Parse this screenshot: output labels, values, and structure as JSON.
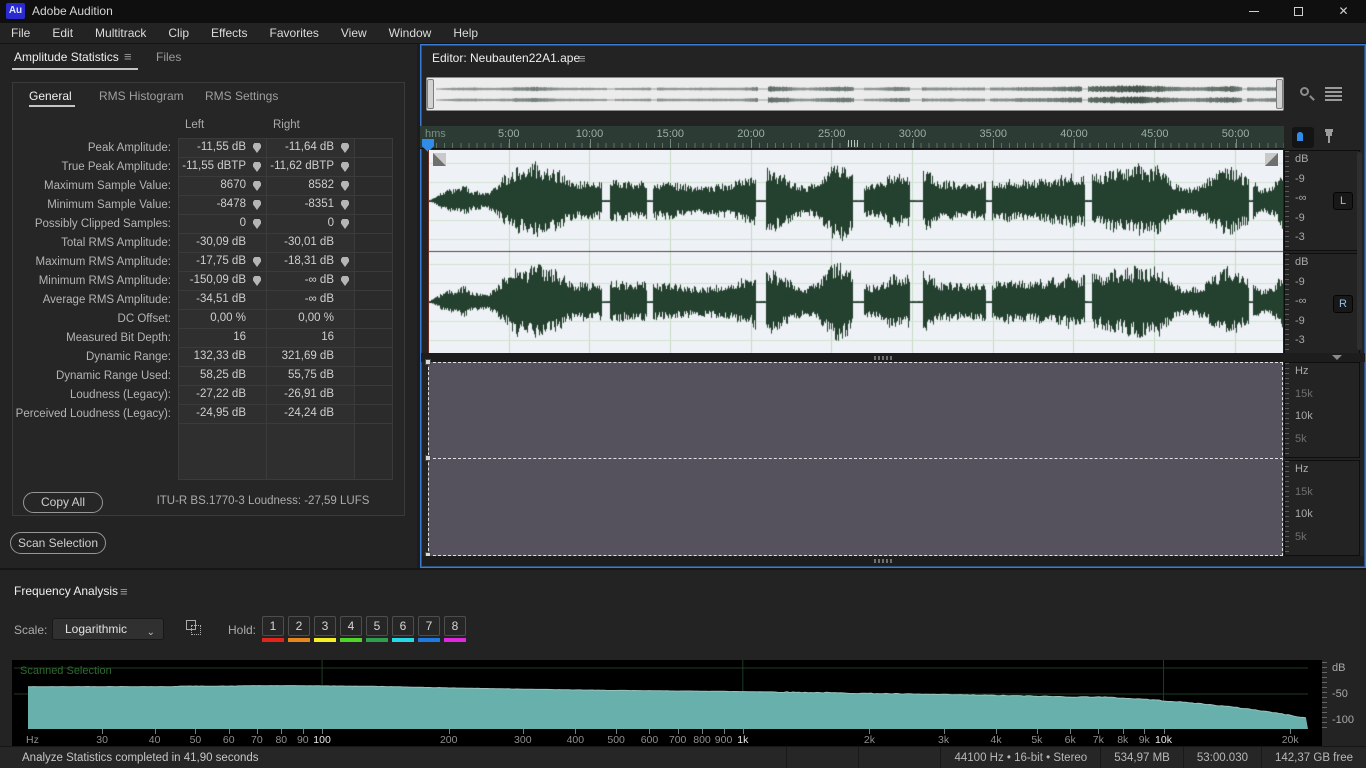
{
  "titlebar": {
    "logo": "Au",
    "title": "Adobe Audition",
    "minimize_glyph": "–",
    "close_glyph": "✕"
  },
  "menubar": {
    "items": [
      "File",
      "Edit",
      "Multitrack",
      "Clip",
      "Effects",
      "Favorites",
      "View",
      "Window",
      "Help"
    ]
  },
  "stats_panel": {
    "tabs": [
      {
        "label": "Amplitude Statistics",
        "active": true
      },
      {
        "label": "Files",
        "active": false
      }
    ],
    "menu_icon": "≡",
    "inner_tabs": [
      {
        "label": "General",
        "active": true
      },
      {
        "label": "RMS Histogram",
        "active": false
      },
      {
        "label": "RMS Settings",
        "active": false
      }
    ],
    "columns": [
      "Left",
      "Right"
    ],
    "rows": [
      {
        "label": "Peak Amplitude:",
        "left": "-11,55 dB",
        "right": "-11,64 dB",
        "pins": true
      },
      {
        "label": "True Peak Amplitude:",
        "left": "-11,55 dBTP",
        "right": "-11,62 dBTP",
        "pins": true
      },
      {
        "label": "Maximum Sample Value:",
        "left": "8670",
        "right": "8582",
        "pins": true
      },
      {
        "label": "Minimum Sample Value:",
        "left": "-8478",
        "right": "-8351",
        "pins": true
      },
      {
        "label": "Possibly Clipped Samples:",
        "left": "0",
        "right": "0",
        "pins": true
      },
      {
        "label": "Total RMS Amplitude:",
        "left": "-30,09 dB",
        "right": "-30,01 dB",
        "pins": false
      },
      {
        "label": "Maximum RMS Amplitude:",
        "left": "-17,75 dB",
        "right": "-18,31 dB",
        "pins": true
      },
      {
        "label": "Minimum RMS Amplitude:",
        "left": "-150,09 dB",
        "right": "-∞ dB",
        "pins": true
      },
      {
        "label": "Average RMS Amplitude:",
        "left": "-34,51 dB",
        "right": "-∞ dB",
        "pins": false
      },
      {
        "label": "DC Offset:",
        "left": "0,00 %",
        "right": "0,00 %",
        "pins": false
      },
      {
        "label": "Measured Bit Depth:",
        "left": "16",
        "right": "16",
        "pins": false
      },
      {
        "label": "Dynamic Range:",
        "left": "132,33 dB",
        "right": "321,69 dB",
        "pins": false
      },
      {
        "label": "Dynamic Range Used:",
        "left": "58,25 dB",
        "right": "55,75 dB",
        "pins": false
      },
      {
        "label": "Loudness (Legacy):",
        "left": "-27,22 dB",
        "right": "-26,91 dB",
        "pins": false
      },
      {
        "label": "Perceived Loudness (Legacy):",
        "left": "-24,95 dB",
        "right": "-24,24 dB",
        "pins": false
      }
    ],
    "copy_all_label": "Copy All",
    "itu_loudness": "ITU-R BS.1770-3 Loudness:  -27,59 LUFS",
    "scan_selection_label": "Scan Selection"
  },
  "editor": {
    "tab_label": "Editor: Neubauten22A1.ape",
    "menu_icon": "≡",
    "timeline": {
      "unit": "hms",
      "total_minutes": 53,
      "label_minutes": [
        5,
        10,
        15,
        20,
        25,
        30,
        35,
        40,
        45,
        50
      ],
      "labels": [
        "5:00",
        "10:00",
        "15:00",
        "20:00",
        "25:00",
        "30:00",
        "35:00",
        "40:00",
        "45:00",
        "50:00"
      ]
    },
    "db_scale": [
      "dB",
      "-9",
      "-∞",
      "-9",
      "-3"
    ],
    "hz_scale": [
      {
        "label": "Hz",
        "dim": false
      },
      {
        "label": "15k",
        "dim": true
      },
      {
        "label": "10k",
        "dim": false
      },
      {
        "label": "5k",
        "dim": true
      }
    ],
    "channels": [
      {
        "label": "L"
      },
      {
        "label": "R"
      }
    ],
    "waveform": {
      "seed": 7,
      "ramp_end": 0.045,
      "gaps": [
        [
          0,
          0.003
        ],
        [
          0.203,
          0.2125
        ],
        [
          0.2555,
          0.262
        ],
        [
          0.383,
          0.3945
        ],
        [
          0.497,
          0.5095
        ],
        [
          0.5635,
          0.578
        ],
        [
          0.6525,
          0.6585
        ],
        [
          0.768,
          0.7755
        ],
        [
          0.9595,
          0.9645
        ]
      ],
      "wave_color": "#24402e",
      "bg": "#eef1f5",
      "grid_h": "#d2e4d2",
      "grid_v": "#c6dcc6",
      "center_line": "#3c3c3c"
    },
    "spectrogram": {
      "palette_stops": [
        0,
        0.22,
        0.42,
        0.58,
        0.72,
        0.84,
        1
      ],
      "palette_rgb": [
        [
          86,
          82,
          94
        ],
        [
          99,
          88,
          110
        ],
        [
          125,
          90,
          134
        ],
        [
          176,
          94,
          150
        ],
        [
          224,
          105,
          154
        ],
        [
          240,
          138,
          120
        ],
        [
          255,
          184,
          102
        ]
      ]
    }
  },
  "freq_panel": {
    "title": "Frequency Analysis",
    "menu_icon": "≡",
    "scale_label": "Scale:",
    "scale_value": "Logarithmic",
    "chevron": "⌄",
    "hold_label": "Hold:",
    "hold_buttons": [
      {
        "label": "1",
        "color": "#e1251b"
      },
      {
        "label": "2",
        "color": "#e8871e"
      },
      {
        "label": "3",
        "color": "#f5ef28"
      },
      {
        "label": "4",
        "color": "#50d428"
      },
      {
        "label": "5",
        "color": "#2f9e4f"
      },
      {
        "label": "6",
        "color": "#28d8e8"
      },
      {
        "label": "7",
        "color": "#1e7ae0"
      },
      {
        "label": "8",
        "color": "#e028e0"
      }
    ]
  },
  "chart_data": {
    "type": "area",
    "title": "Scanned Selection",
    "xlabel": "Hz",
    "ylabel": "dB",
    "x_scale": "log",
    "x_range_hz": [
      20,
      22050
    ],
    "ylim": [
      -110,
      10
    ],
    "grid_hz": [
      100,
      1000,
      10000
    ],
    "grid_db": [
      0,
      -50
    ],
    "x_ticks": [
      {
        "label": "Hz",
        "f": 20,
        "bright": false,
        "edge": true
      },
      {
        "label": "30",
        "f": 30,
        "bright": false
      },
      {
        "label": "40",
        "f": 40,
        "bright": false
      },
      {
        "label": "50",
        "f": 50,
        "bright": false
      },
      {
        "label": "60",
        "f": 60,
        "bright": false
      },
      {
        "label": "70",
        "f": 70,
        "bright": false
      },
      {
        "label": "80",
        "f": 80,
        "bright": false
      },
      {
        "label": "90",
        "f": 90,
        "bright": false
      },
      {
        "label": "100",
        "f": 100,
        "bright": true
      },
      {
        "label": "200",
        "f": 200,
        "bright": false
      },
      {
        "label": "300",
        "f": 300,
        "bright": false
      },
      {
        "label": "400",
        "f": 400,
        "bright": false
      },
      {
        "label": "500",
        "f": 500,
        "bright": false
      },
      {
        "label": "600",
        "f": 600,
        "bright": false
      },
      {
        "label": "700",
        "f": 700,
        "bright": false
      },
      {
        "label": "800",
        "f": 800,
        "bright": false
      },
      {
        "label": "900",
        "f": 900,
        "bright": false
      },
      {
        "label": "1k",
        "f": 1000,
        "bright": true
      },
      {
        "label": "2k",
        "f": 2000,
        "bright": false
      },
      {
        "label": "3k",
        "f": 3000,
        "bright": false
      },
      {
        "label": "4k",
        "f": 4000,
        "bright": false
      },
      {
        "label": "5k",
        "f": 5000,
        "bright": false
      },
      {
        "label": "6k",
        "f": 6000,
        "bright": false
      },
      {
        "label": "7k",
        "f": 7000,
        "bright": false
      },
      {
        "label": "8k",
        "f": 8000,
        "bright": false
      },
      {
        "label": "9k",
        "f": 9000,
        "bright": false
      },
      {
        "label": "10k",
        "f": 10000,
        "bright": true
      },
      {
        "label": "20k",
        "f": 20000,
        "bright": false
      }
    ],
    "y_ticks": [
      {
        "label": "dB",
        "db": 0
      },
      {
        "label": "-50",
        "db": -50
      },
      {
        "label": "-100",
        "db": -100
      }
    ],
    "series": [
      {
        "name": "Scanned Selection",
        "points": [
          [
            20,
            -36
          ],
          [
            30,
            -35.8
          ],
          [
            44,
            -35.9
          ],
          [
            46,
            -34.9
          ],
          [
            62,
            -34.9
          ],
          [
            64,
            -34.2
          ],
          [
            78,
            -33.9
          ],
          [
            100,
            -34.4
          ],
          [
            130,
            -35.2
          ],
          [
            160,
            -36.6
          ],
          [
            200,
            -38.2
          ],
          [
            260,
            -39.8
          ],
          [
            320,
            -41
          ],
          [
            400,
            -42.2
          ],
          [
            500,
            -43.2
          ],
          [
            630,
            -43.9
          ],
          [
            800,
            -44.6
          ],
          [
            1000,
            -45.4
          ],
          [
            1300,
            -46.6
          ],
          [
            1600,
            -47.6
          ],
          [
            2000,
            -48.9
          ],
          [
            2500,
            -50.2
          ],
          [
            3150,
            -51.4
          ],
          [
            4000,
            -52.8
          ],
          [
            5000,
            -54.2
          ],
          [
            6300,
            -55.8
          ],
          [
            7000,
            -55.4
          ],
          [
            8000,
            -58
          ],
          [
            9000,
            -60
          ],
          [
            10000,
            -63
          ],
          [
            12000,
            -68
          ],
          [
            14000,
            -73.5
          ],
          [
            16000,
            -79
          ],
          [
            18000,
            -85
          ],
          [
            20000,
            -91
          ],
          [
            22050,
            -97
          ]
        ]
      }
    ],
    "fill_color": "#67b0ab",
    "line_color": "#98c2be",
    "bg": "#000000",
    "grid_color": "#1d3d22"
  },
  "statusbar": {
    "left": "Analyze Statistics completed in 41,90 seconds",
    "cells": [
      "",
      "",
      "44100 Hz • 16-bit • Stereo",
      "534,97 MB",
      "53:00.030",
      "142,37 GB free"
    ]
  }
}
